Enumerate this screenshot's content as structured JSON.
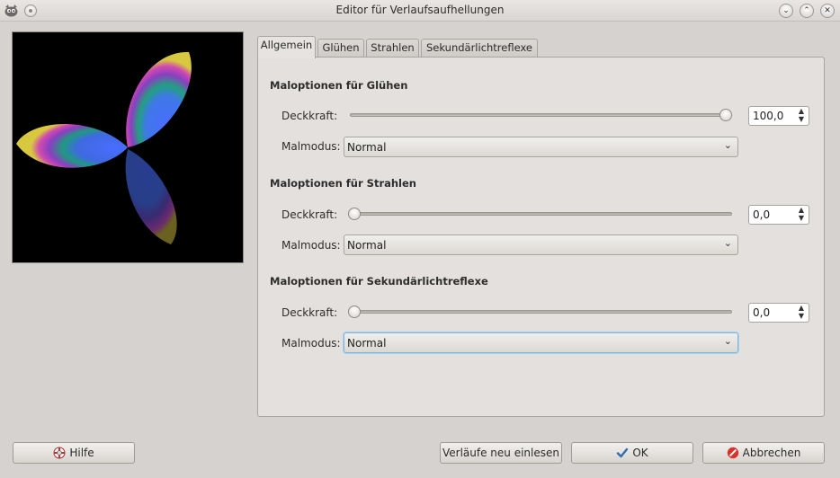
{
  "window": {
    "title": "Editor für Verlaufsaufhellungen",
    "controls": {
      "minimize": "⌄",
      "maximize": "⌃",
      "close": "✕"
    }
  },
  "tabs": [
    {
      "label": "Allgemein",
      "active": true
    },
    {
      "label": "Glühen",
      "active": false
    },
    {
      "label": "Strahlen",
      "active": false
    },
    {
      "label": "Sekundärlichtreflexe",
      "active": false
    }
  ],
  "sections": [
    {
      "title": "Maloptionen für Glühen",
      "opacity_label": "Deckkraft:",
      "opacity_value": "100,0",
      "opacity_fraction": 1.0,
      "mode_label": "Malmodus:",
      "mode_value": "Normal"
    },
    {
      "title": "Maloptionen für Strahlen",
      "opacity_label": "Deckkraft:",
      "opacity_value": "0,0",
      "opacity_fraction": 0.0,
      "mode_label": "Malmodus:",
      "mode_value": "Normal"
    },
    {
      "title": "Maloptionen für Sekundärlichtreflexe",
      "opacity_label": "Deckkraft:",
      "opacity_value": "0,0",
      "opacity_fraction": 0.0,
      "mode_label": "Malmodus:",
      "mode_value": "Normal"
    }
  ],
  "buttons": {
    "help": "Hilfe",
    "reload": "Verläufe neu einlesen",
    "ok": "OK",
    "cancel": "Abbrechen"
  },
  "icons": {
    "app": "gimp-icon",
    "help": "help-lifebuoy-icon",
    "ok": "checkmark-icon",
    "cancel": "cancel-icon"
  },
  "colors": {
    "window_bg": "#d6d2cf",
    "panel_bg": "#e3e0dd",
    "focus": "#7fb6dd"
  }
}
